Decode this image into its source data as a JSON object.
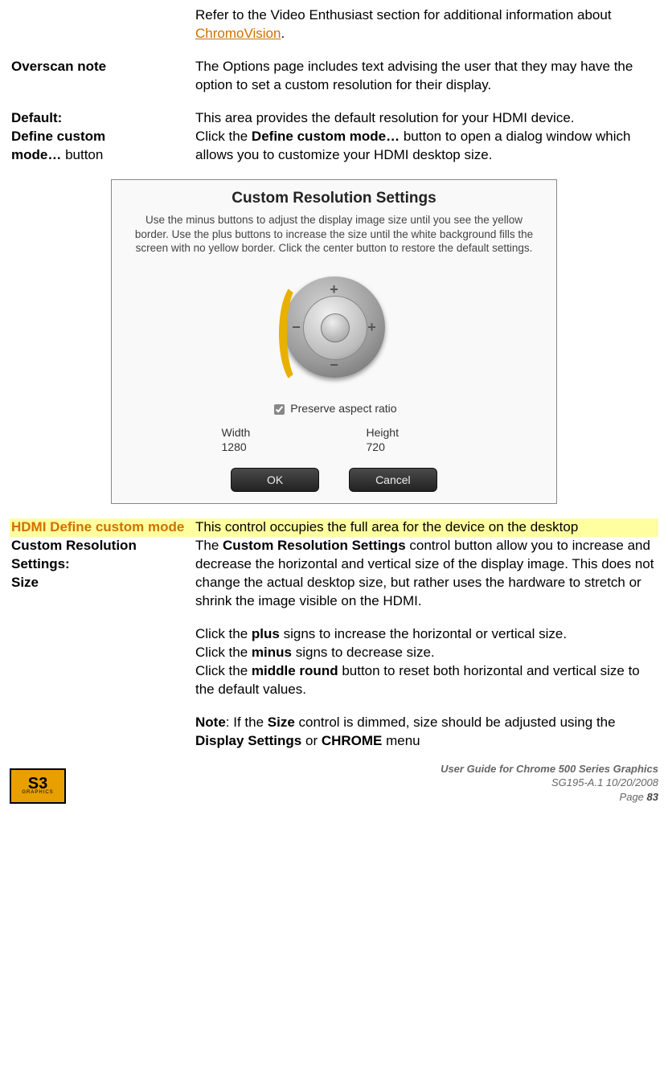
{
  "intro": {
    "pre": "Refer to the Video Enthusiast section for additional information about ",
    "link": "ChromoVision",
    "post": "."
  },
  "rows": {
    "overscan": {
      "term": "Overscan note",
      "text": "The Options page includes text advising the user that they may have the option to set a custom resolution for their display."
    },
    "default": {
      "term": "Default:",
      "text": "This area provides the default resolution for your HDMI device."
    },
    "define": {
      "term1": "Define custom",
      "term2": "mode…",
      "term3": " button",
      "pre": "Click the ",
      "bold": "Define custom mode…",
      "post": " button to open a dialog window which allows you to customize your HDMI desktop size."
    },
    "hdmi": {
      "term": "HDMI Define custom mode",
      "text": "This control occupies the full area for the device on the desktop"
    },
    "custom": {
      "term": "Custom Resolution Settings: Size",
      "p1a": "The ",
      "p1b": "Custom Resolution Settings",
      "p1c": " control button allow you to increase and decrease the horizontal and vertical size of the display image. This does not change the actual desktop size, but rather uses the hardware to stretch or shrink the image visible on the HDMI.",
      "p2a": "Click the ",
      "p2b": "plus",
      "p2c": " signs to increase the horizontal or vertical size.",
      "p3a": "Click the ",
      "p3b": "minus",
      "p3c": " signs to decrease size.",
      "p4a": "Click the ",
      "p4b": "middle round",
      "p4c": " button to reset both horizontal and vertical size to the default values.",
      "p5a": "Note",
      "p5b": ": If the ",
      "p5c": "Size",
      "p5d": " control is dimmed, size should be adjusted using the ",
      "p5e": "Display Settings",
      "p5f": " or ",
      "p5g": "CHROME",
      "p5h": " menu"
    }
  },
  "dialog": {
    "title": "Custom Resolution Settings",
    "desc": "Use the minus buttons to adjust the display image size until you see the yellow border. Use the plus buttons to increase the size until the white background fills the screen with no yellow border. Click the center button to restore the default settings.",
    "preserve": "Preserve aspect ratio",
    "width_lbl": "Width",
    "width_val": "1280",
    "height_lbl": "Height",
    "height_val": "720",
    "ok": "OK",
    "cancel": "Cancel"
  },
  "footer": {
    "logo_main": "S3",
    "logo_sub": "GRAPHICS",
    "line1": "User Guide for Chrome 500 Series Graphics",
    "line2": "SG195-A.1   10/20/2008",
    "page_lbl": "Page ",
    "page_num": "83"
  }
}
